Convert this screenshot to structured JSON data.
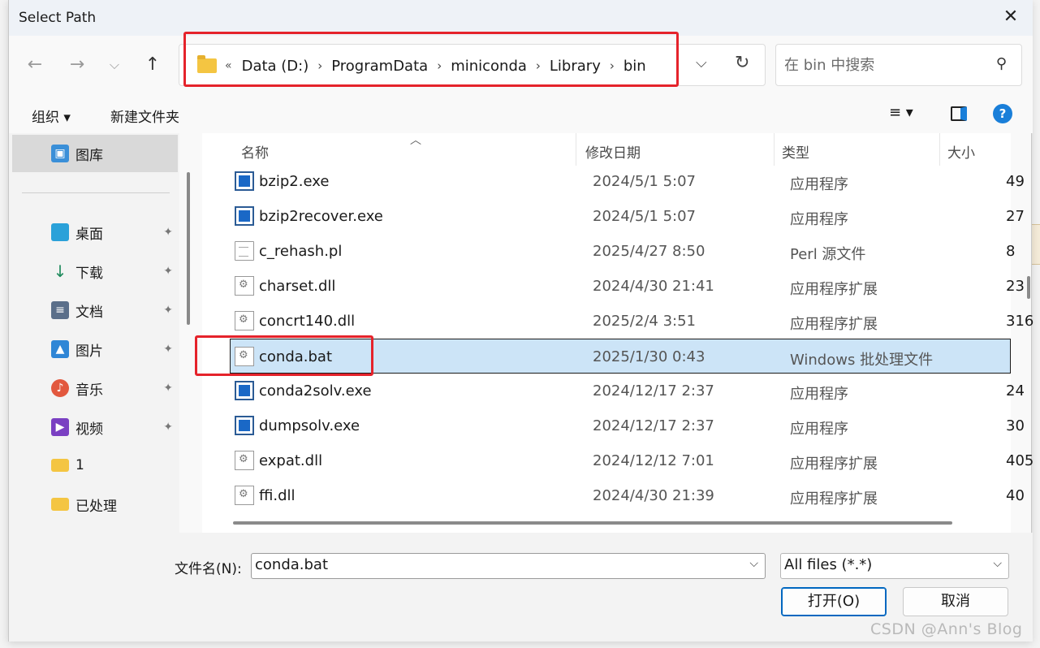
{
  "dialog": {
    "title": "Select Path"
  },
  "nav": {
    "back_icon": "←",
    "forward_icon": "→",
    "recent_icon": "⌄",
    "up_icon": "↑",
    "chevron_icon": "«",
    "breadcrumbs": [
      "Data (D:)",
      "ProgramData",
      "miniconda",
      "Library",
      "bin"
    ],
    "separator": "›",
    "dropdown_icon": "⌄",
    "refresh_icon": "↻",
    "search_placeholder": "在 bin 中搜索",
    "search_icon": "⚲"
  },
  "toolbar": {
    "organize": "组织 ▾",
    "new_folder": "新建文件夹",
    "view_icon": "≡ ▾",
    "preview_icon": "▮",
    "help": "?"
  },
  "sidebar": {
    "gallery": "图库",
    "items": [
      {
        "label": "桌面",
        "icon": "desktop-icon",
        "color": "#2aa1d9",
        "pinned": true
      },
      {
        "label": "下载",
        "icon": "download-icon",
        "color": "#1e8a5c",
        "pinned": true
      },
      {
        "label": "文档",
        "icon": "documents-icon",
        "color": "#5b6f8a",
        "pinned": true
      },
      {
        "label": "图片",
        "icon": "pictures-icon",
        "color": "#2f86d6",
        "pinned": true
      },
      {
        "label": "音乐",
        "icon": "music-icon",
        "color": "#e2583e",
        "pinned": true
      },
      {
        "label": "视频",
        "icon": "videos-icon",
        "color": "#7a3fc2",
        "pinned": true
      },
      {
        "label": "1",
        "icon": "folder-icon",
        "color": "#f4c542",
        "pinned": false
      },
      {
        "label": "已处理",
        "icon": "folder-icon",
        "color": "#f4c542",
        "pinned": false
      }
    ],
    "pin_icon": "📌"
  },
  "columns": {
    "name": "名称",
    "modified": "修改日期",
    "type": "类型",
    "size": "大小",
    "sort_icon": "^"
  },
  "files": [
    {
      "name": "bzip2.exe",
      "date": "2024/5/1 5:07",
      "type": "应用程序",
      "size": "49",
      "icon": "exe"
    },
    {
      "name": "bzip2recover.exe",
      "date": "2024/5/1 5:07",
      "type": "应用程序",
      "size": "27",
      "icon": "exe"
    },
    {
      "name": "c_rehash.pl",
      "date": "2025/4/27 8:50",
      "type": "Perl 源文件",
      "size": "8",
      "icon": "doc"
    },
    {
      "name": "charset.dll",
      "date": "2024/4/30 21:41",
      "type": "应用程序扩展",
      "size": "23",
      "icon": "gear"
    },
    {
      "name": "concrt140.dll",
      "date": "2025/2/4 3:51",
      "type": "应用程序扩展",
      "size": "316",
      "icon": "gear"
    },
    {
      "name": "conda.bat",
      "date": "2025/1/30 0:43",
      "type": "Windows 批处理文件",
      "size": "",
      "icon": "gear",
      "selected": true
    },
    {
      "name": "conda2solv.exe",
      "date": "2024/12/17 2:37",
      "type": "应用程序",
      "size": "24",
      "icon": "exe"
    },
    {
      "name": "dumpsolv.exe",
      "date": "2024/12/17 2:37",
      "type": "应用程序",
      "size": "30",
      "icon": "exe"
    },
    {
      "name": "expat.dll",
      "date": "2024/12/12 7:01",
      "type": "应用程序扩展",
      "size": "405",
      "icon": "gear"
    },
    {
      "name": "ffi.dll",
      "date": "2024/4/30 21:39",
      "type": "应用程序扩展",
      "size": "40",
      "icon": "gear"
    }
  ],
  "bottom": {
    "filename_label": "文件名(N):",
    "filename_value": "conda.bat",
    "filetype_value": "All files (*.*)",
    "open_button": "打开(O)",
    "cancel_button": "取消"
  },
  "watermark": "CSDN @Ann's Blog",
  "colors": {
    "selection": "#cce4f7",
    "highlight_box": "#e5232b",
    "accent": "#0067c0"
  }
}
